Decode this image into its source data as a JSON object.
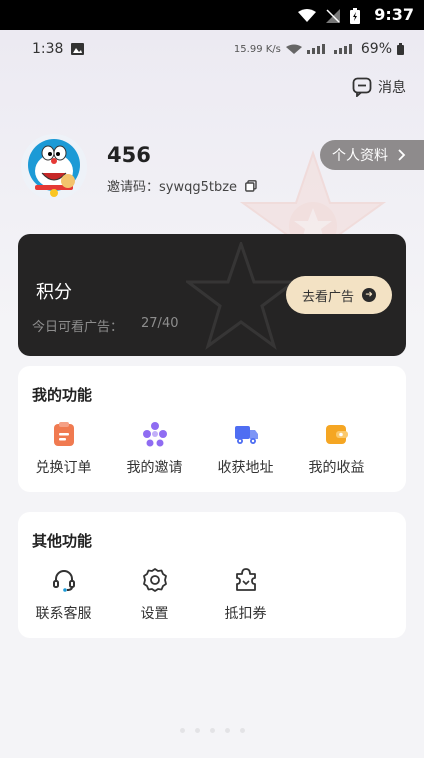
{
  "system_status": {
    "time": "9:37"
  },
  "inner_status": {
    "time": "1:38",
    "speed": "15.99 K/s",
    "battery": "69%"
  },
  "message": {
    "label": "消息"
  },
  "profile": {
    "username": "456",
    "invite_label": "邀请码：",
    "invite_code": "sywqg5tbze",
    "profile_button": "个人资料"
  },
  "points": {
    "title": "积分",
    "ads_label": "今日可看广告：",
    "ads_count": "27/40",
    "ad_button": "去看广告"
  },
  "my_functions": {
    "title": "我的功能",
    "items": [
      {
        "label": "兑换订单",
        "icon": "clipboard-icon",
        "color": "#f07a50"
      },
      {
        "label": "我的邀请",
        "icon": "people-icon",
        "color": "#8f6cf2"
      },
      {
        "label": "收获地址",
        "icon": "truck-icon",
        "color": "#4f6ef2"
      },
      {
        "label": "我的收益",
        "icon": "wallet-icon",
        "color": "#f5a623"
      }
    ]
  },
  "other_functions": {
    "title": "其他功能",
    "items": [
      {
        "label": "联系客服",
        "icon": "headset-icon"
      },
      {
        "label": "设置",
        "icon": "gear-icon"
      },
      {
        "label": "抵扣券",
        "icon": "coupon-icon"
      }
    ]
  }
}
